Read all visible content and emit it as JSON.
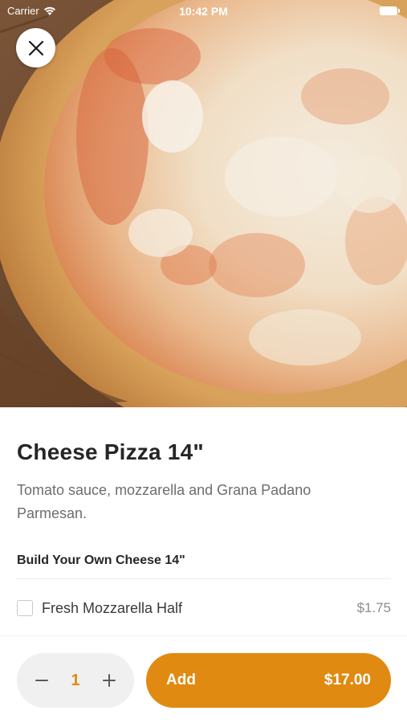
{
  "status_bar": {
    "carrier": "Carrier",
    "time": "10:42 PM"
  },
  "hero": {
    "image_subject": "cheese pizza photo"
  },
  "close_button": {
    "icon": "close-icon"
  },
  "item": {
    "title": "Cheese Pizza 14\"",
    "description": "Tomato sauce, mozzarella and Grana Padano Parmesan."
  },
  "options_section": {
    "header": "Build Your Own Cheese 14\"",
    "options": [
      {
        "label": "Fresh Mozzarella Half",
        "price": "$1.75",
        "checked": false
      }
    ]
  },
  "cart_bar": {
    "quantity": "1",
    "add_label": "Add",
    "total": "$17.00"
  },
  "colors": {
    "accent": "#e08a12",
    "title_text": "#262626",
    "muted_text": "#6d6d6d",
    "stepper_bg": "#f0f0f0"
  }
}
